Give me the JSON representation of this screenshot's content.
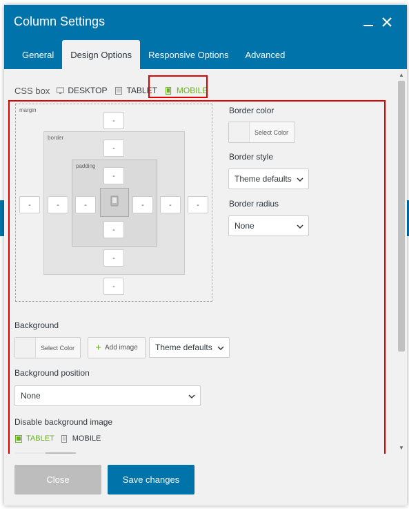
{
  "dialog": {
    "title": "Column Settings",
    "minimize_icon": "minus-icon",
    "close_icon": "close-icon"
  },
  "tabs": [
    {
      "label": "General",
      "active": false
    },
    {
      "label": "Design Options",
      "active": true
    },
    {
      "label": "Responsive Options",
      "active": false
    },
    {
      "label": "Advanced",
      "active": false
    }
  ],
  "css_box": {
    "label": "CSS box",
    "devices": [
      {
        "label": "DESKTOP",
        "icon": "desktop-icon",
        "active": false
      },
      {
        "label": "TABLET",
        "icon": "tablet-icon",
        "active": false
      },
      {
        "label": "MOBILE",
        "icon": "mobile-icon",
        "active": true
      }
    ]
  },
  "box_model": {
    "margin_label": "margin",
    "border_label": "border",
    "padding_label": "padding",
    "placeholder": "-",
    "content_icon": "mobile-icon"
  },
  "border_color": {
    "label": "Border color",
    "button": "Select Color"
  },
  "border_style": {
    "label": "Border style",
    "value": "Theme defaults"
  },
  "border_radius": {
    "label": "Border radius",
    "value": "None"
  },
  "background": {
    "label": "Background",
    "color_button": "Select Color",
    "add_image": "Add image",
    "style_value": "Theme defaults"
  },
  "background_position": {
    "label": "Background position",
    "value": "None"
  },
  "disable_bg": {
    "label": "Disable background image",
    "devices": [
      {
        "label": "TABLET",
        "icon": "tablet-icon",
        "active": true
      },
      {
        "label": "MOBILE",
        "icon": "mobile-icon",
        "active": false
      }
    ]
  },
  "footer": {
    "close": "Close",
    "save": "Save changes"
  },
  "colors": {
    "header": "#0073aa",
    "active_device": "#6ab023",
    "highlight_box": "#e00000",
    "close_button": "#bdbdbd"
  }
}
